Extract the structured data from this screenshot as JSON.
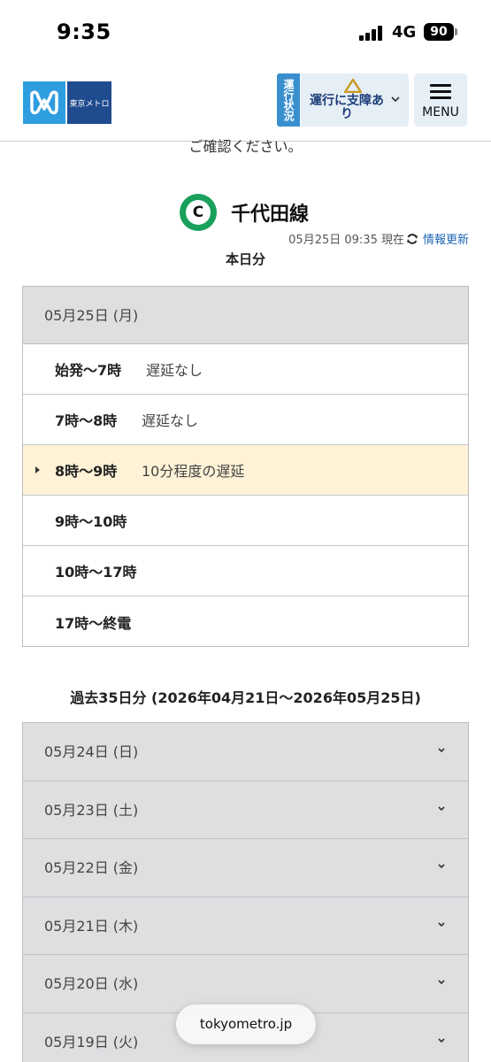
{
  "statusBar": {
    "time": "9:35",
    "network": "4G",
    "battery": "90"
  },
  "header": {
    "logo_text": "東京メトロ",
    "status_tab": "運行状況",
    "status_label": "運行に支障あり",
    "menu_label": "MENU"
  },
  "notice_cut": "ご確認ください。",
  "line": {
    "badge": "C",
    "name": "千代田線",
    "color": "#19a05c",
    "updated": "05月25日 09:35 現在",
    "refresh_label": "情報更新"
  },
  "today": {
    "title": "本日分",
    "date": "05月25日 (月)",
    "slots": [
      {
        "time": "始発〜7時",
        "status": "遅延なし"
      },
      {
        "time": "7時〜8時",
        "status": "遅延なし"
      },
      {
        "time": "8時〜9時",
        "status": "10分程度の遅延"
      },
      {
        "time": "9時〜10時",
        "status": ""
      },
      {
        "time": "10時〜17時",
        "status": ""
      },
      {
        "time": "17時〜終電",
        "status": ""
      }
    ]
  },
  "past": {
    "title": "過去35日分 (2026年04月21日〜2026年05月25日)",
    "days": [
      "05月24日 (日)",
      "05月23日 (土)",
      "05月22日 (金)",
      "05月21日 (木)",
      "05月20日 (水)",
      "05月19日 (火)"
    ]
  },
  "browser": {
    "url": "tokyometro.jp"
  }
}
